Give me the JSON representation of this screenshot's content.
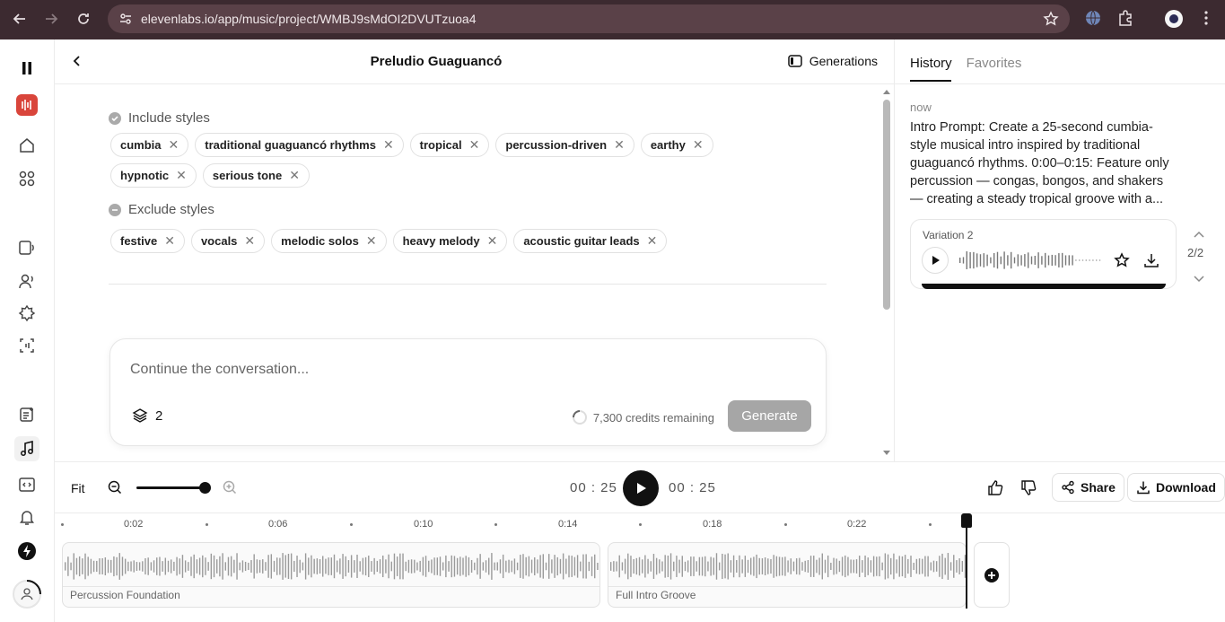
{
  "browser": {
    "url": "elevenlabs.io/app/music/project/WMBJ9sMdOI2DVUTzuoa4"
  },
  "header": {
    "title": "Preludio Guaguancó",
    "generations_label": "Generations"
  },
  "include": {
    "label": "Include styles",
    "tags": [
      "cumbia",
      "traditional guaguancó rhythms",
      "tropical",
      "percussion-driven",
      "earthy",
      "hypnotic",
      "serious tone"
    ]
  },
  "exclude": {
    "label": "Exclude styles",
    "tags": [
      "festive",
      "vocals",
      "melodic solos",
      "heavy melody",
      "acoustic guitar leads"
    ]
  },
  "composer": {
    "placeholder": "Continue the conversation...",
    "layers_count": "2",
    "credits": "7,300 credits remaining",
    "generate_label": "Generate"
  },
  "history": {
    "tabs": [
      "History",
      "Favorites"
    ],
    "time": "now",
    "prompt": "Intro Prompt: Create a 25-second cumbia-style musical intro inspired by traditional guaguancó rhythms. 0:00–0:15: Feature only percussion — congas, bongos, and shakers — creating a steady tropical groove with a...",
    "variation_label": "Variation 2",
    "pager": "2/2"
  },
  "transport": {
    "fit_label": "Fit",
    "current_time": "00 : 25",
    "total_time": "00 : 25",
    "share_label": "Share",
    "download_label": "Download",
    "zoom_level": 1.0
  },
  "timeline": {
    "ticks": [
      "0:02",
      "0:06",
      "0:10",
      "0:14",
      "0:18",
      "0:22"
    ],
    "clips": [
      {
        "name": "Percussion Foundation"
      },
      {
        "name": "Full Intro Groove"
      }
    ]
  }
}
